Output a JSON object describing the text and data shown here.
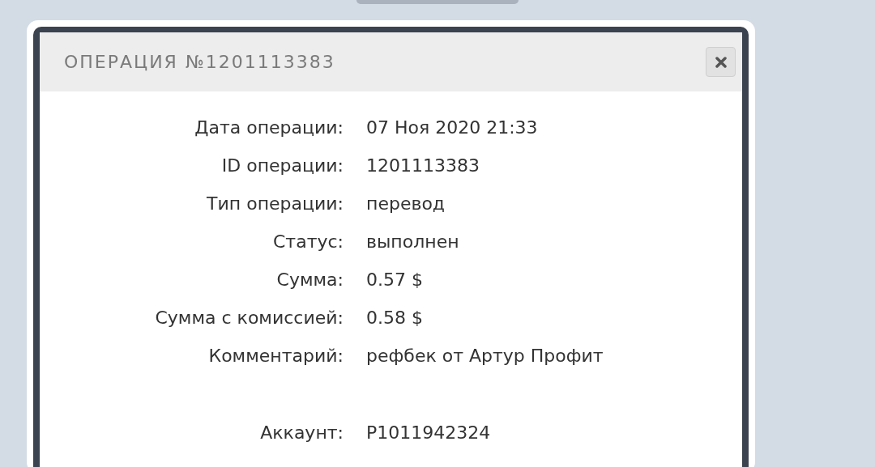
{
  "dialog": {
    "title": "ОПЕРАЦИЯ №1201113383",
    "fields": [
      {
        "label": "Дата операции:",
        "value": "07 Ноя 2020 21:33"
      },
      {
        "label": "ID операции:",
        "value": "1201113383"
      },
      {
        "label": "Тип операции:",
        "value": "перевод"
      },
      {
        "label": "Статус:",
        "value": "выполнен"
      },
      {
        "label": "Сумма:",
        "value": "0.57 $"
      },
      {
        "label": "Сумма с комиссией:",
        "value": "0.58 $"
      },
      {
        "label": "Комментарий:",
        "value": "рефбек от Артур Профит"
      }
    ],
    "extra_fields": [
      {
        "label": "Аккаунт:",
        "value": "P1011942324"
      }
    ]
  }
}
